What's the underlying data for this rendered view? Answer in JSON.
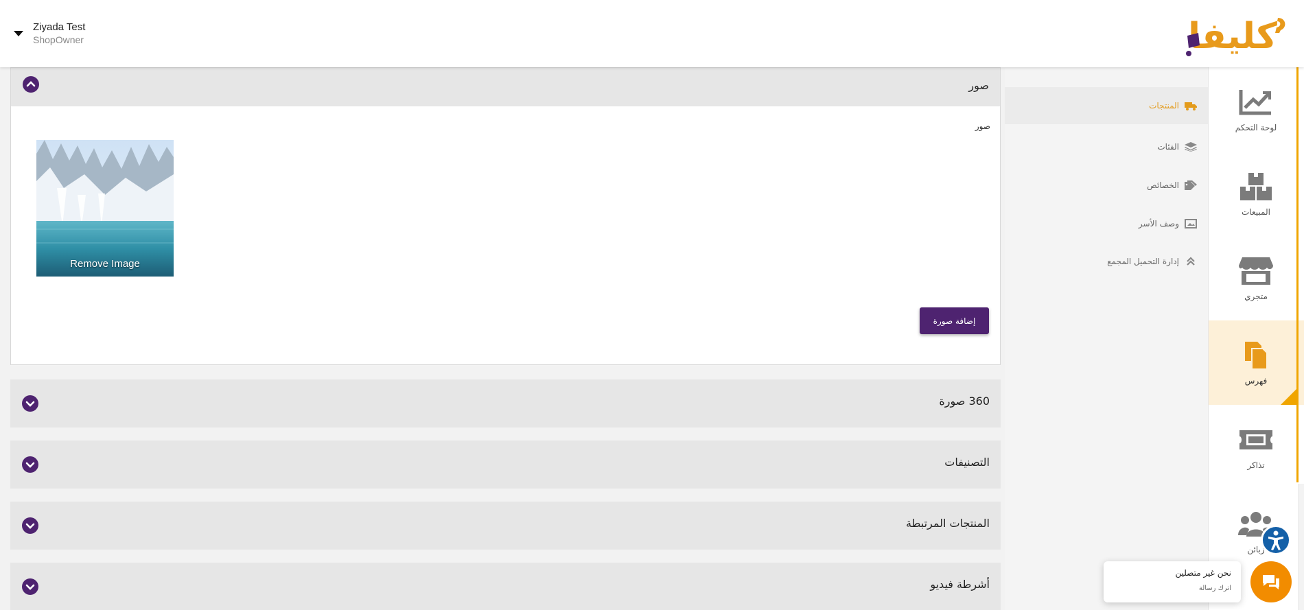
{
  "header": {
    "user_name": "Ziyada Test",
    "user_role": "ShopOwner",
    "logo_text": "كليفا"
  },
  "rail": {
    "items": [
      {
        "label": "لوحة التحكم",
        "icon": "chart-line-icon"
      },
      {
        "label": "المبيعات",
        "icon": "boxes-icon"
      },
      {
        "label": "متجري",
        "icon": "store-icon"
      },
      {
        "label": "فهرس",
        "icon": "copy-icon",
        "active": true
      },
      {
        "label": "تذاكر",
        "icon": "ticket-icon"
      },
      {
        "label": "زبائن",
        "icon": "users-icon"
      }
    ]
  },
  "submenu": {
    "items": [
      {
        "label": "المنتجات",
        "icon": "truck-icon",
        "active": true
      },
      {
        "label": "الفئات",
        "icon": "layers-icon"
      },
      {
        "label": "الخصائص",
        "icon": "tags-icon"
      },
      {
        "label": "وصف الأسر",
        "icon": "image-frame-icon"
      },
      {
        "label": "إدارة التحميل المجمع",
        "icon": "double-chevron-up-icon"
      }
    ]
  },
  "main": {
    "images_panel": {
      "title": "صور",
      "field_label": "صور",
      "remove_label": "Remove Image",
      "add_button": "إضافة صورة"
    },
    "collapsed_panels": [
      {
        "title": "360 صورة"
      },
      {
        "title": "التصنيفات"
      },
      {
        "title": "المنتجات المرتبطة"
      },
      {
        "title": "أشرطة فيديو"
      }
    ]
  },
  "chat": {
    "title": "نحن غير متصلين",
    "subtitle": "اترك رسالة"
  },
  "colors": {
    "brand_purple": "#4e2370",
    "accent_orange": "#f0a500",
    "chat_orange": "#f28c00",
    "accessibility_blue": "#1460a8"
  }
}
